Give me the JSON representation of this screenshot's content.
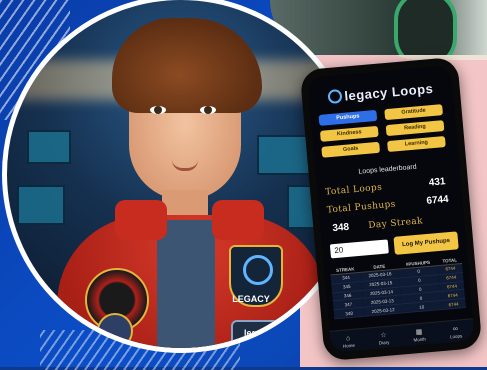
{
  "app": {
    "logo_text": "legacy Loops",
    "buttons": [
      {
        "label": "Pushups",
        "style": "blue"
      },
      {
        "label": "Gratitude",
        "style": "yellow"
      },
      {
        "label": "Kindness",
        "style": "yellow"
      },
      {
        "label": "Reading",
        "style": "yellow"
      },
      {
        "label": "Goals",
        "style": "yellow"
      },
      {
        "label": "Learning",
        "style": "yellow"
      }
    ],
    "leaderboard_title": "Loops leaderboard",
    "stats": {
      "total_loops_label": "Total Loops",
      "total_loops_value": "431",
      "total_pushups_label": "Total Pushups",
      "total_pushups_value": "6744",
      "day_streak_value": "348",
      "day_streak_label": "Day Streak"
    },
    "input_value": "20",
    "log_button": "Log My Pushups",
    "table": {
      "headers": [
        "STREAK",
        "DATE",
        "#PUSHUPS",
        "TOTAL"
      ],
      "rows": [
        [
          "344",
          "2025-03-16",
          "0",
          "6744"
        ],
        [
          "345",
          "2025-03-15",
          "0",
          "6744"
        ],
        [
          "346",
          "2025-03-14",
          "0",
          "6744"
        ],
        [
          "347",
          "2025-03-13",
          "0",
          "6744"
        ],
        [
          "348",
          "2025-03-12",
          "10",
          "6744"
        ]
      ]
    },
    "nav": [
      {
        "icon": "home-icon",
        "label": "Home"
      },
      {
        "icon": "star-icon",
        "label": "Diary"
      },
      {
        "icon": "calendar-icon",
        "label": "Month"
      },
      {
        "icon": "loops-icon",
        "label": "Loops"
      }
    ]
  },
  "patches": {
    "shield_text": "LEGACY",
    "badge_text": "legacy"
  },
  "colors": {
    "accent_yellow": "#f2c544",
    "accent_blue": "#2e6fe8",
    "gold_text": "#e0b64a",
    "jacket_red": "#c72c1e",
    "background_blue": "#0b4fc9",
    "panel_pink": "#f3c5c6"
  }
}
